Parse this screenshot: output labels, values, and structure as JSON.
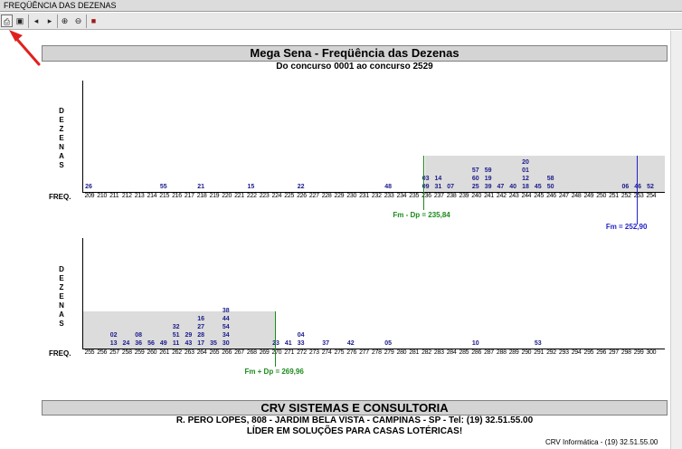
{
  "window": {
    "title": "FREQÜÊNCIA DAS DEZENAS"
  },
  "toolbar": {
    "buttons": [
      {
        "name": "print-icon",
        "glyph": "⎙"
      },
      {
        "name": "export-icon",
        "glyph": "▣"
      },
      {
        "name": "prev-page-icon",
        "glyph": "◂"
      },
      {
        "name": "next-page-icon",
        "glyph": "▸"
      },
      {
        "name": "zoom-in-icon",
        "glyph": "⊕"
      },
      {
        "name": "zoom-out-icon",
        "glyph": "⊖"
      },
      {
        "name": "close-icon",
        "glyph": "■"
      }
    ]
  },
  "report": {
    "title": "Mega Sena - Freqüência das Dezenas",
    "subtitle": "Do concurso 0001 ao concurso 2529",
    "axis_letters": [
      "D",
      "E",
      "Z",
      "E",
      "N",
      "A",
      "S"
    ],
    "freq_label": "FREQ."
  },
  "chart_data": [
    {
      "type": "table",
      "x_range": [
        209,
        254
      ],
      "shaded_from": 236,
      "frequencies": [
        {
          "freq": 209,
          "numbers": [
            "26"
          ]
        },
        {
          "freq": 215,
          "numbers": [
            "55"
          ]
        },
        {
          "freq": 218,
          "numbers": [
            "21"
          ]
        },
        {
          "freq": 222,
          "numbers": [
            "15"
          ]
        },
        {
          "freq": 226,
          "numbers": [
            "22"
          ]
        },
        {
          "freq": 233,
          "numbers": [
            "48"
          ]
        },
        {
          "freq": 236,
          "numbers": [
            "03",
            "09"
          ]
        },
        {
          "freq": 237,
          "numbers": [
            "14",
            "31"
          ]
        },
        {
          "freq": 238,
          "numbers": [
            "07"
          ]
        },
        {
          "freq": 240,
          "numbers": [
            "57",
            "60",
            "25"
          ]
        },
        {
          "freq": 241,
          "numbers": [
            "59",
            "19",
            "39"
          ]
        },
        {
          "freq": 242,
          "numbers": [
            "47"
          ]
        },
        {
          "freq": 243,
          "numbers": [
            "40"
          ]
        },
        {
          "freq": 244,
          "numbers": [
            "20",
            "01",
            "12",
            "18"
          ]
        },
        {
          "freq": 245,
          "numbers": [
            "45"
          ]
        },
        {
          "freq": 246,
          "numbers": [
            "58",
            "50"
          ]
        },
        {
          "freq": 252,
          "numbers": [
            "06"
          ]
        },
        {
          "freq": 253,
          "numbers": [
            "46"
          ]
        },
        {
          "freq": 254,
          "numbers": [
            "52"
          ]
        }
      ],
      "markers": [
        {
          "label": "Fm - Dp = 235,84",
          "value": 235.84,
          "color": "#1c8a1c"
        },
        {
          "label": "Fm = 252,90",
          "value": 252.9,
          "color": "#2222cc"
        }
      ]
    },
    {
      "type": "table",
      "x_range": [
        255,
        300
      ],
      "shaded_to": 270,
      "frequencies": [
        {
          "freq": 257,
          "numbers": [
            "02",
            "13"
          ]
        },
        {
          "freq": 258,
          "numbers": [
            "24"
          ]
        },
        {
          "freq": 259,
          "numbers": [
            "08",
            "36"
          ]
        },
        {
          "freq": 260,
          "numbers": [
            "56"
          ]
        },
        {
          "freq": 261,
          "numbers": [
            "49"
          ]
        },
        {
          "freq": 262,
          "numbers": [
            "32",
            "51",
            "11"
          ]
        },
        {
          "freq": 263,
          "numbers": [
            "29",
            "43"
          ]
        },
        {
          "freq": 264,
          "numbers": [
            "16",
            "27",
            "28",
            "17"
          ]
        },
        {
          "freq": 265,
          "numbers": [
            "35"
          ]
        },
        {
          "freq": 266,
          "numbers": [
            "38",
            "44",
            "54",
            "34",
            "30"
          ]
        },
        {
          "freq": 270,
          "numbers": [
            "23"
          ]
        },
        {
          "freq": 271,
          "numbers": [
            "41"
          ]
        },
        {
          "freq": 272,
          "numbers": [
            "04",
            "33"
          ]
        },
        {
          "freq": 274,
          "numbers": [
            "37"
          ]
        },
        {
          "freq": 276,
          "numbers": [
            "42"
          ]
        },
        {
          "freq": 279,
          "numbers": [
            "05"
          ]
        },
        {
          "freq": 286,
          "numbers": [
            "10"
          ]
        },
        {
          "freq": 291,
          "numbers": [
            "53"
          ]
        }
      ],
      "markers": [
        {
          "label": "Fm + Dp = 269,96",
          "value": 269.96,
          "color": "#1c8a1c"
        }
      ]
    }
  ],
  "footer": {
    "company": "CRV SISTEMAS E CONSULTORIA",
    "address": "R. PERO LOPES, 808 - JARDIM BELA VISTA - CAMPINAS - SP - Tel: (19) 32.51.55.00",
    "slogan": "LÍDER  EM  SOLUÇÕES  PARA  CASAS  LOTÉRICAS!",
    "credit": "CRV Informática - (19) 32.51.55.00"
  },
  "colors": {
    "shade": "#dcdcdc",
    "numbers": "#1a1a8c",
    "arrow": "#e02020"
  }
}
